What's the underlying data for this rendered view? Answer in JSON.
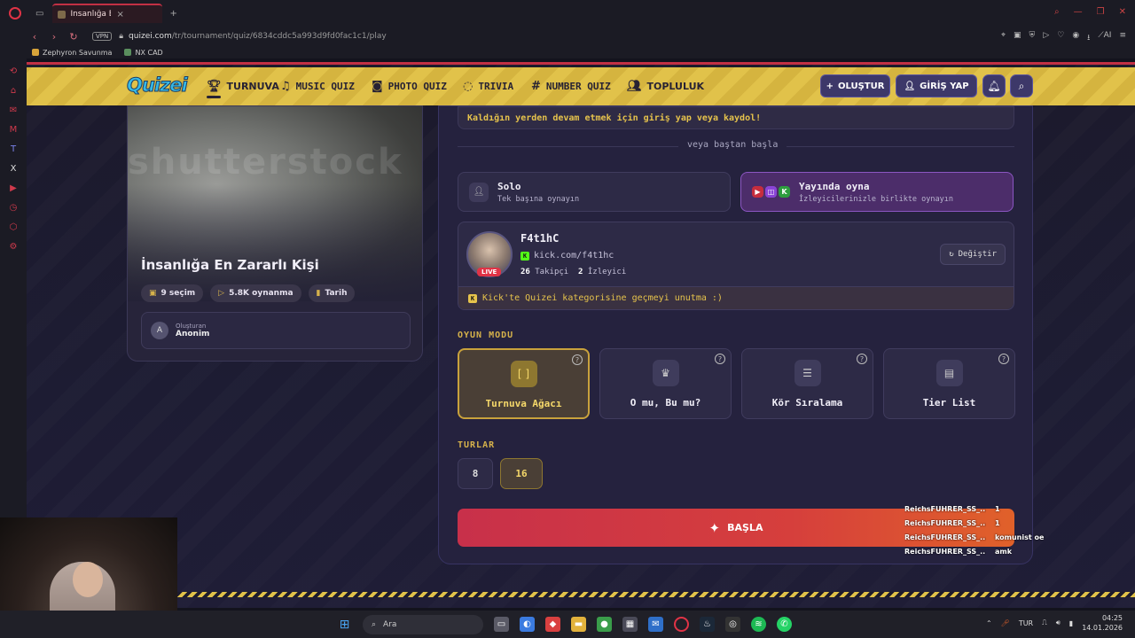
{
  "browser": {
    "tab_title": "İnsanlığa En Zararlı Kişi - T",
    "url_host": "quizei.com",
    "url_path": "/tr/tournament/quiz/6834cddc5a993d9fd0fac1c1/play",
    "vpn_label": "VPN",
    "bookmarks": [
      "Zephyron Savunma",
      "NX CAD"
    ],
    "ai_label": "AI"
  },
  "navbar": {
    "logo": "Quizei",
    "items": [
      "TURNUVA",
      "MUSIC QUIZ",
      "PHOTO QUIZ",
      "TRIVIA",
      "NUMBER QUIZ",
      "TOPLULUK"
    ],
    "create_label": "OLUŞTUR",
    "login_label": "GİRİŞ YAP"
  },
  "quiz": {
    "watermark": "shutterstock",
    "title": "İnsanlığa En Zararlı Kişi",
    "choices": "9 seçim",
    "plays": "5.8K oynanma",
    "category": "Tarih",
    "creator_label": "Oluşturan",
    "creator_initial": "A",
    "creator_name": "Anonim"
  },
  "play": {
    "continue_notice": "Kaldığın yerden devam etmek için giriş yap veya kaydol!",
    "divider_text": "veya baştan başla",
    "solo_title": "Solo",
    "solo_sub": "Tek başına oynayın",
    "live_title": "Yayında oyna",
    "live_sub": "İzleyicilerinizle birlikte oynayın"
  },
  "streamer": {
    "name": "F4t1hC",
    "url": "kick.com/f4t1hc",
    "followers": "26",
    "followers_label": "Takipçi",
    "viewers": "2",
    "viewers_label": "İzleyici",
    "live_badge": "LIVE",
    "change_label": "Değiştir",
    "hint": "Kick'te Quizei kategorisine geçmeyi unutma :)"
  },
  "game_mode": {
    "label": "OYUN MODU",
    "modes": [
      "Turnuva Ağacı",
      "O mu, Bu mu?",
      "Kör Sıralama",
      "Tier List"
    ],
    "selected": "Turnuva Ağacı"
  },
  "rounds": {
    "label": "TURLAR",
    "options": [
      "8",
      "16"
    ],
    "selected": "16"
  },
  "start_label": "BAŞLA",
  "chat": [
    {
      "user": "ReichsFUHRER_SS_...",
      "msg": "1"
    },
    {
      "user": "ReichsFUHRER_SS_...",
      "msg": "1"
    },
    {
      "user": "ReichsFUHRER_SS_...",
      "msg": "komunist oe"
    },
    {
      "user": "ReichsFUHRER_SS_...",
      "msg": "amk"
    }
  ],
  "taskbar": {
    "search_placeholder": "Ara",
    "lang": "TUR",
    "time": "04:25",
    "date": "14.01.2026"
  },
  "colors": {
    "accent_red": "#c23044",
    "navbar_yellow": "#e1c24a",
    "gold": "#d6b24b",
    "kick_green": "#53fc18",
    "card_bg": "#25223e"
  }
}
